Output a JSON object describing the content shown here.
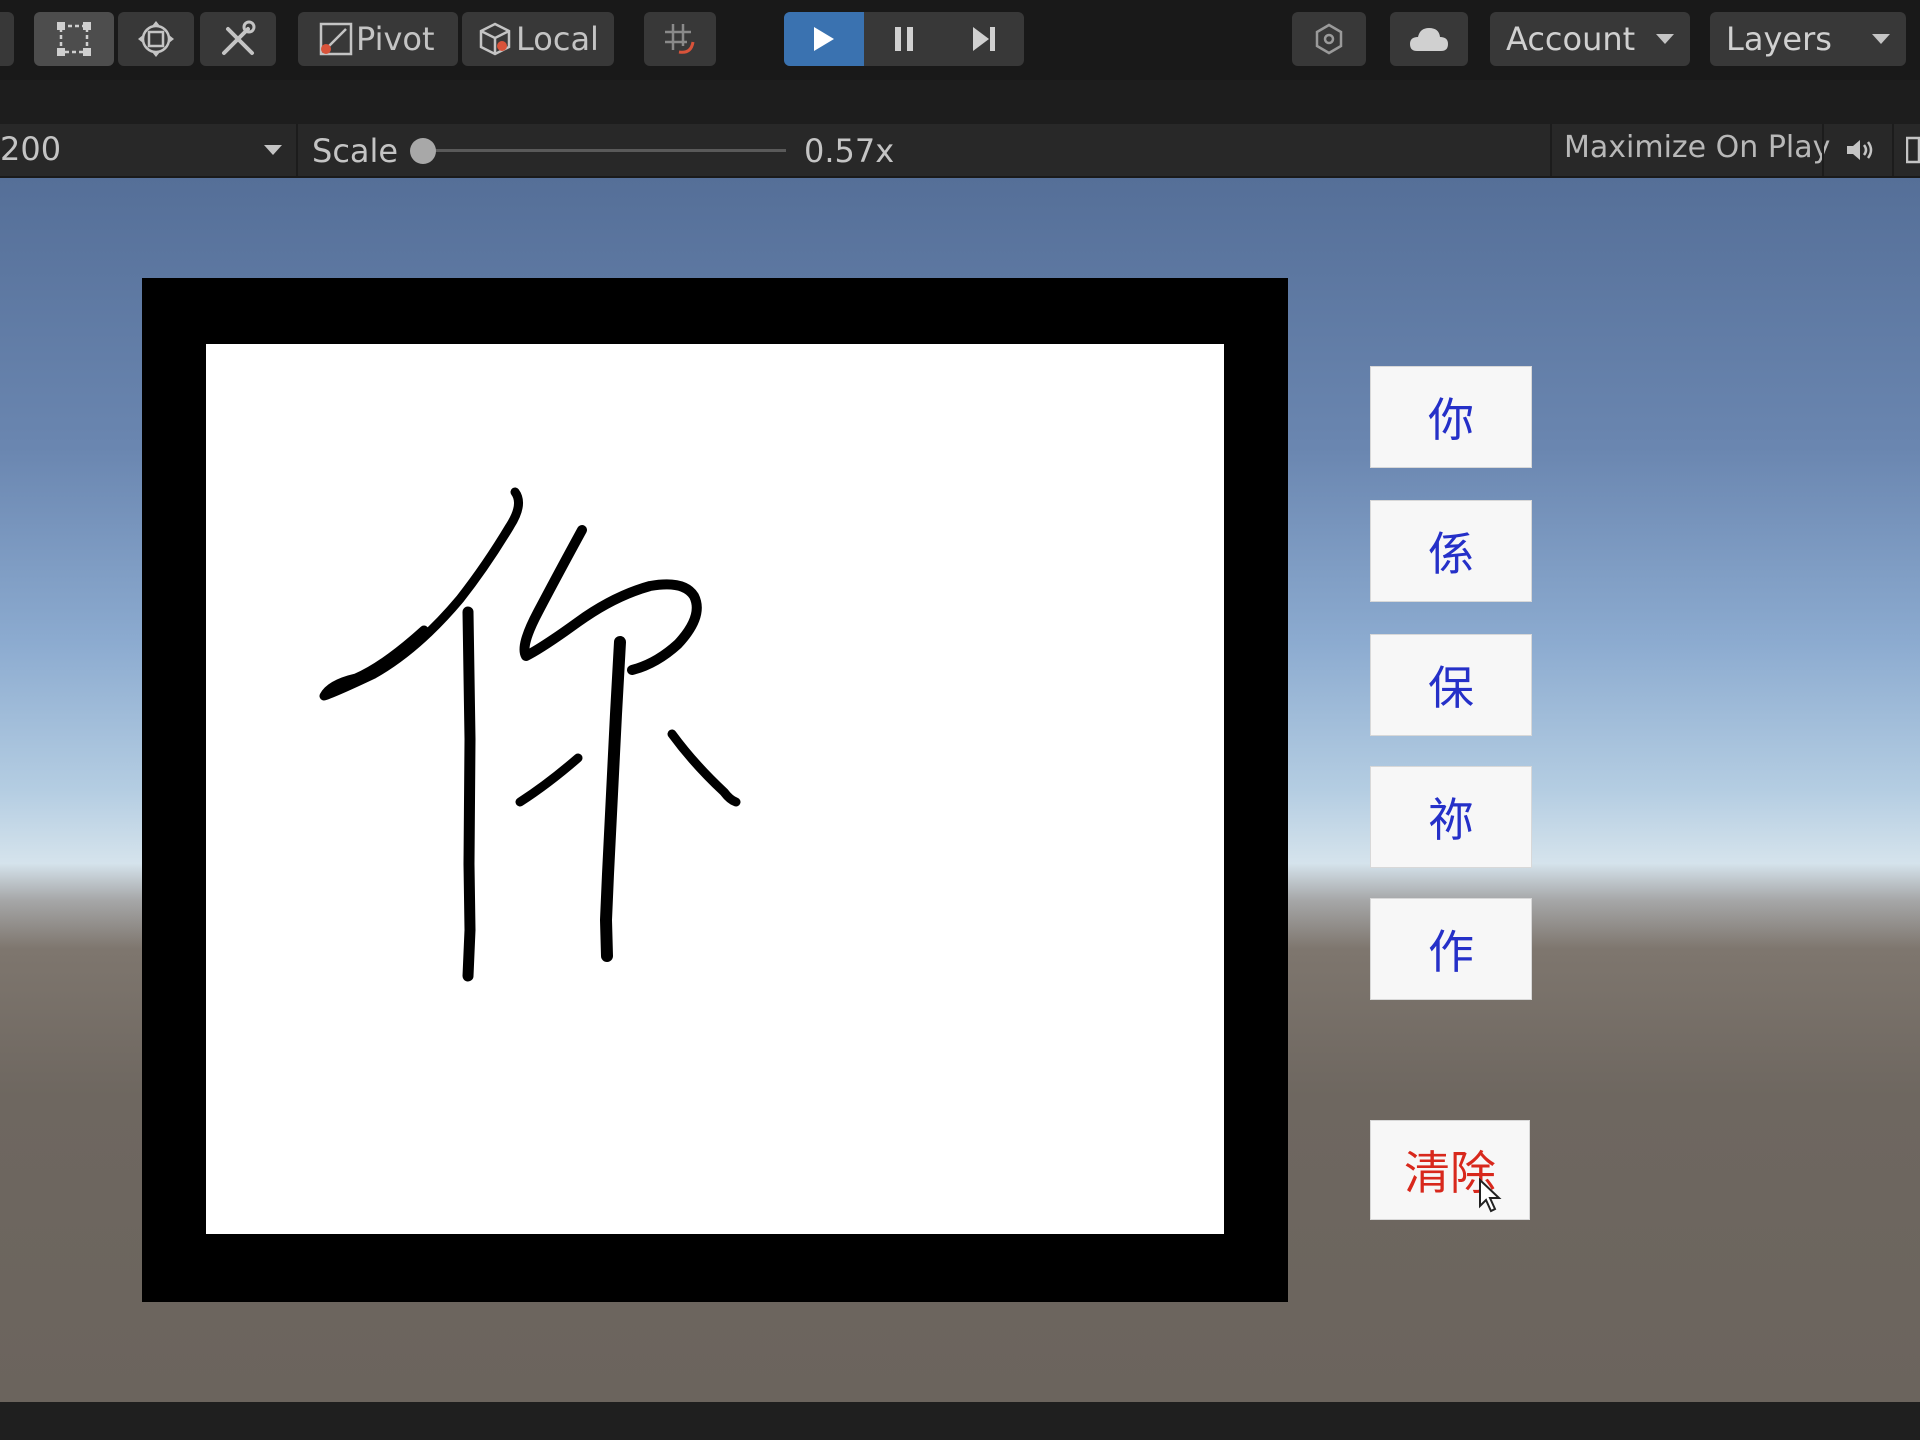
{
  "toolbar": {
    "pivot_label": "Pivot",
    "local_label": "Local",
    "account_label": "Account",
    "layers_label": "Layers",
    "play_active": true
  },
  "gamebar": {
    "resolution_value": "200",
    "scale_label": "Scale",
    "scale_value": "0.57x",
    "maximize_label": "Maximize On Play"
  },
  "candidates": [
    "你",
    "係",
    "保",
    "祢",
    "作"
  ],
  "clear_label": "清除",
  "colors": {
    "candidate_text": "#2530c8",
    "clear_text": "#d8281c",
    "play_active": "#3a72b0"
  }
}
